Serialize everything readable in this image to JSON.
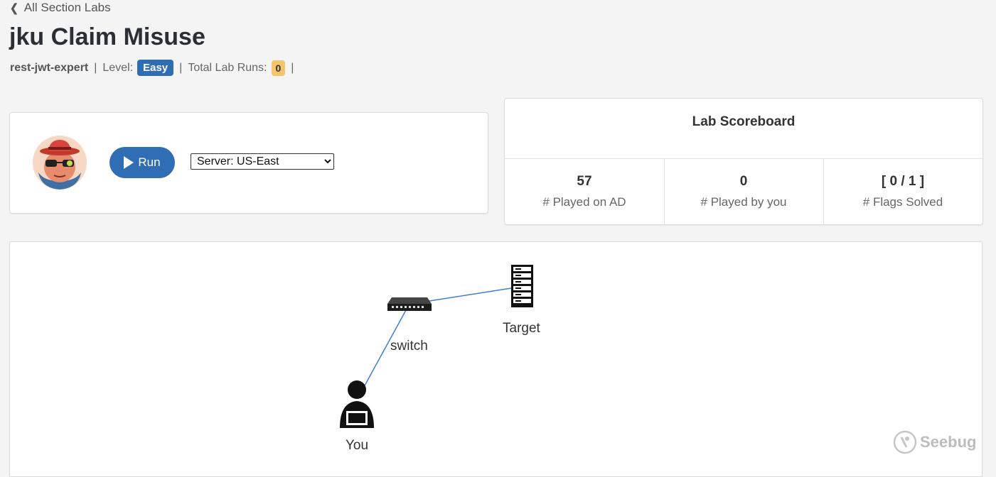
{
  "nav": {
    "back_label": "All Section Labs"
  },
  "lab": {
    "title": "jku Claim Misuse",
    "author": "rest-jwt-expert",
    "level_label": "Level:",
    "level": "Easy",
    "runs_label": "Total Lab Runs:",
    "runs": "0",
    "sep": "|"
  },
  "run_panel": {
    "run_label": "Run",
    "server_selected": "Server: US-East"
  },
  "scoreboard": {
    "title": "Lab Scoreboard",
    "stats": [
      {
        "value": "57",
        "label": "# Played on AD"
      },
      {
        "value": "0",
        "label": "# Played by you"
      },
      {
        "value": "[ 0 / 1 ]",
        "label": "# Flags Solved"
      }
    ]
  },
  "topology": {
    "nodes": {
      "switch": "switch",
      "target": "Target",
      "you": "You"
    },
    "link_color": "#3c7fd6"
  },
  "watermark": "Seebug",
  "colors": {
    "primary": "#2f6db5",
    "runs_badge": "#f5c46b"
  }
}
